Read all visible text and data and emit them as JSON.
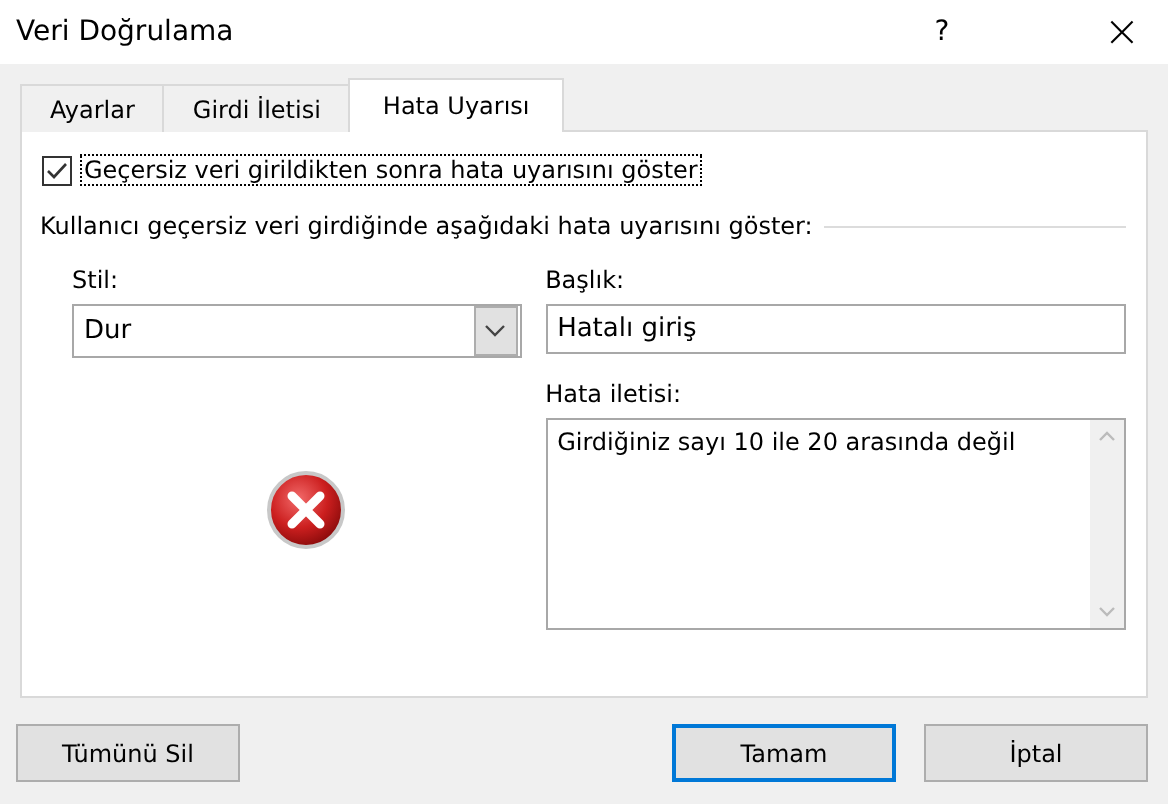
{
  "window": {
    "title": "Veri Doğrulama",
    "help": "?",
    "close": "×"
  },
  "tabs": [
    {
      "label": "Ayarlar",
      "selected": false
    },
    {
      "label": "Girdi İletisi",
      "selected": false
    },
    {
      "label": "Hata Uyarısı",
      "selected": true
    }
  ],
  "show_error": {
    "label": "Geçersiz veri girildikten sonra hata uyarısını göster",
    "checked": true
  },
  "section_label": "Kullanıcı geçersiz veri girdiğinde aşağıdaki hata uyarısını göster:",
  "style": {
    "label": "Stil:",
    "value": "Dur",
    "kind": "stop"
  },
  "title_field": {
    "label": "Başlık:",
    "value": "Hatalı giriş"
  },
  "message_field": {
    "label": "Hata iletisi:",
    "value": "Girdiğiniz sayı 10 ile 20 arasında değil"
  },
  "buttons": [
    {
      "label": "Tümünü Sil",
      "default": false
    },
    {
      "label": "Tamam",
      "default": true
    },
    {
      "label": "İptal",
      "default": false
    }
  ]
}
